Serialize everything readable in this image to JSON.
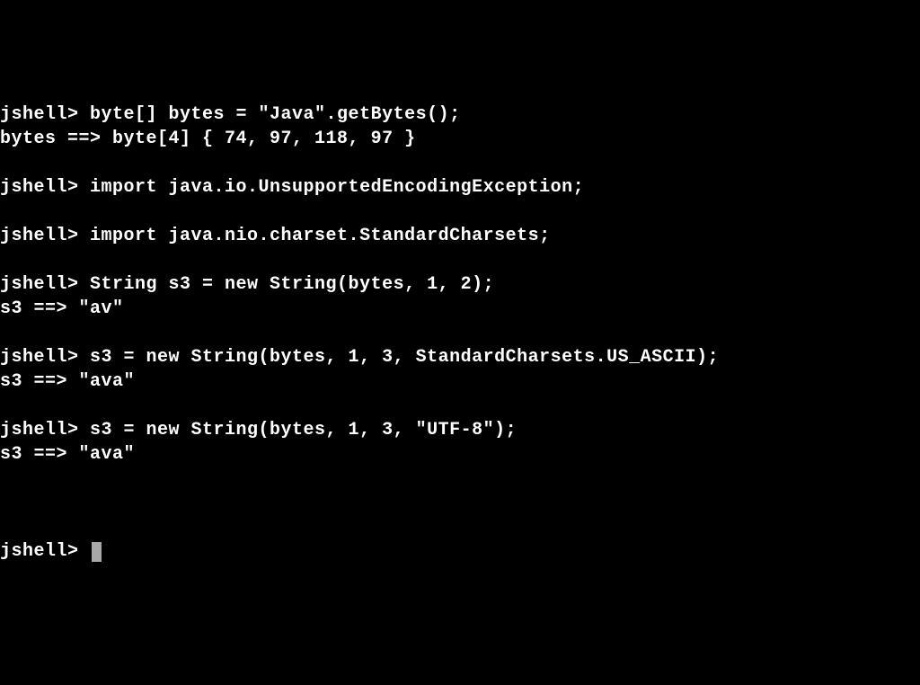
{
  "terminal": {
    "prompt": "jshell> ",
    "lines": [
      {
        "type": "input",
        "text": "jshell> byte[] bytes = \"Java\".getBytes();"
      },
      {
        "type": "output",
        "text": "bytes ==> byte[4] { 74, 97, 118, 97 }"
      },
      {
        "type": "blank",
        "text": ""
      },
      {
        "type": "input",
        "text": "jshell> import java.io.UnsupportedEncodingException;"
      },
      {
        "type": "blank",
        "text": ""
      },
      {
        "type": "input",
        "text": "jshell> import java.nio.charset.StandardCharsets;"
      },
      {
        "type": "blank",
        "text": ""
      },
      {
        "type": "input",
        "text": "jshell> String s3 = new String(bytes, 1, 2);"
      },
      {
        "type": "output",
        "text": "s3 ==> \"av\""
      },
      {
        "type": "blank",
        "text": ""
      },
      {
        "type": "input",
        "text": "jshell> s3 = new String(bytes, 1, 3, StandardCharsets.US_ASCII);"
      },
      {
        "type": "output",
        "text": "s3 ==> \"ava\""
      },
      {
        "type": "blank",
        "text": ""
      },
      {
        "type": "input",
        "text": "jshell> s3 = new String(bytes, 1, 3, \"UTF-8\");"
      },
      {
        "type": "output",
        "text": "s3 ==> \"ava\""
      },
      {
        "type": "blank",
        "text": ""
      }
    ],
    "cursor_prompt": "jshell> "
  }
}
